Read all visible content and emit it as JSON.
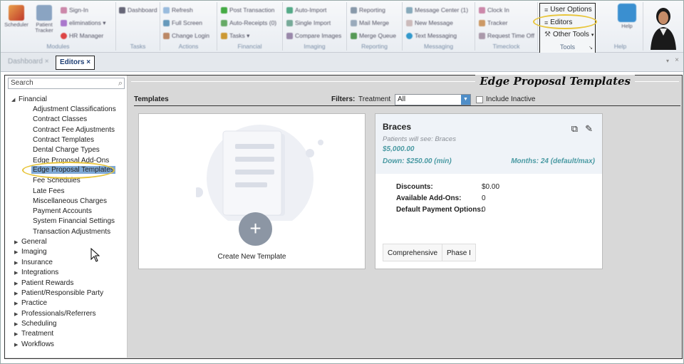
{
  "ribbon": {
    "modules": {
      "scheduler": "Scheduler",
      "patient_tracker": "Patient Tracker",
      "sign_in": "Sign-In",
      "eliminations": "eliminations ▾",
      "hr_manager": "HR Manager",
      "group": "Modules"
    },
    "tasks": {
      "dashboard": "Dashboard",
      "group": "Tasks"
    },
    "actions": {
      "refresh": "Refresh",
      "full_screen": "Full Screen",
      "change_login": "Change Login",
      "group": "Actions"
    },
    "financial": {
      "post_transaction": "Post Transaction",
      "auto_receipts": "Auto-Receipts (0)",
      "tasks": "Tasks ▾",
      "group": "Financial"
    },
    "imaging": {
      "auto_import": "Auto-Import",
      "single_import": "Single Import",
      "compare_images": "Compare Images",
      "group": "Imaging"
    },
    "reporting": {
      "reporting": "Reporting",
      "mail_merge": "Mail Merge",
      "merge_queue": "Merge Queue",
      "group": "Reporting"
    },
    "messaging": {
      "message_center": "Message Center (1)",
      "new_message": "New Message",
      "text_messaging": "Text Messaging",
      "group": "Messaging"
    },
    "timeclock": {
      "clock_in": "Clock In",
      "tracker": "Tracker",
      "request_time_off": "Request Time Off",
      "group": "Timeclock"
    },
    "tools": {
      "user_options": "User Options",
      "editors": "Editors",
      "other_tools": "Other Tools",
      "group": "Tools"
    },
    "help": {
      "help": "Help",
      "group": "Help"
    }
  },
  "tabs": {
    "dashboard": "Dashboard",
    "editors": "Editors"
  },
  "sidebar": {
    "search_placeholder": "Search",
    "financial": "Financial",
    "financial_items": [
      "Adjustment Classifications",
      "Contract Classes",
      "Contract Fee Adjustments",
      "Contract Templates",
      "Dental Charge Types",
      "Edge Proposal Add-Ons",
      "Edge Proposal Templates",
      "Fee Schedules",
      "Late Fees",
      "Miscellaneous Charges",
      "Payment Accounts",
      "System Financial Settings",
      "Transaction Adjustments"
    ],
    "groups": [
      "General",
      "Imaging",
      "Insurance",
      "Integrations",
      "Patient Rewards",
      "Patient/Responsible Party",
      "Practice",
      "Professionals/Referrers",
      "Scheduling",
      "Treatment",
      "Workflows"
    ]
  },
  "page": {
    "title": "Edge Proposal Templates",
    "templates_label": "Templates",
    "filters_label": "Filters:",
    "treatment_label": "Treatment",
    "treatment_value": "All",
    "include_inactive": "Include Inactive",
    "create_new": "Create New Template"
  },
  "template": {
    "name": "Braces",
    "patients_see": "Patients will see: Braces",
    "price": "$5,000.00",
    "down": "Down: $250.00 (min)",
    "months": "Months: 24 (default/max)",
    "discounts_label": "Discounts:",
    "discounts_value": "$0.00",
    "addons_label": "Available Add-Ons:",
    "addons_value": "0",
    "payment_label": "Default Payment Options:",
    "payment_value": "0",
    "tags": [
      "Comprehensive",
      "Phase I"
    ]
  }
}
